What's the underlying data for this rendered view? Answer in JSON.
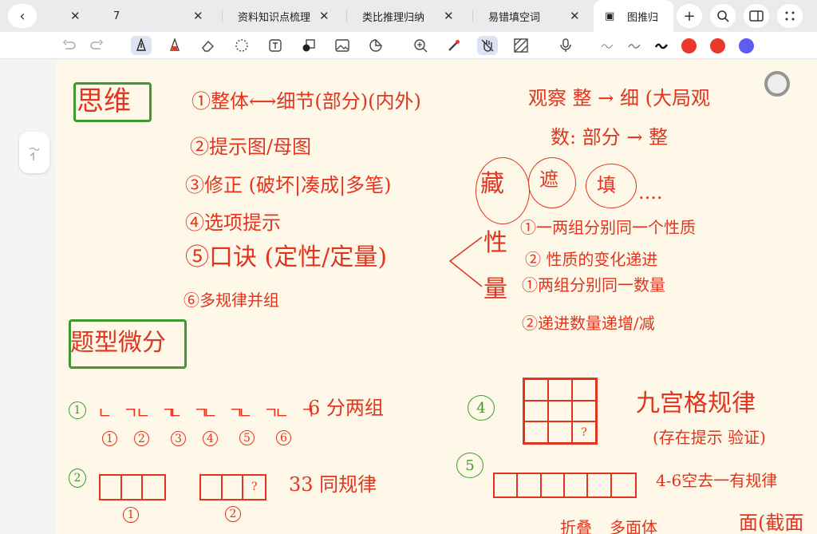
{
  "tabs": [
    {
      "label": "7"
    },
    {
      "label": "资料知识点梳理"
    },
    {
      "label": "类比推理归纳"
    },
    {
      "label": "易错填空词"
    },
    {
      "label": "图推归"
    }
  ],
  "colors": {
    "red1": "#e8392b",
    "red2": "#e8392b",
    "blue": "#5b5cf0",
    "ink_red": "#e2341e",
    "ink_green": "#3e9a2c"
  },
  "notes": {
    "title_siwei": "思维",
    "line1": "①整体⟷细节(部分)(内外)",
    "line2": "②提示图/母图",
    "line3": "③修正 (破坏|凑成|多笔)",
    "line4": "④选项提示",
    "line5": "⑤口诀 (定性/定量)",
    "line6": "⑥多规律并组",
    "observe1": "观察 整 → 细 (大局观",
    "observe2": "数: 部分 → 整",
    "cang": "藏",
    "zhe": "遮",
    "tian": "填",
    "dots": "....",
    "xing": "性",
    "liang": "量",
    "r1": "①一两组分别同一个性质",
    "r2": "② 性质的变化递进",
    "r3": "①两组分别同一数量",
    "r4": "②递进数量递增/减",
    "title_tixing": "题型微分",
    "s1_num": "1",
    "s1_glyph": "ㄴㄱ",
    "s1_labels": [
      "1",
      "2",
      "3",
      "4",
      "5",
      "6"
    ],
    "s1_desc": "6 分两组",
    "s2_num": "2",
    "s2_q": "?",
    "s2_lbl1": "1",
    "s2_lbl2": "2",
    "s2_desc": "33 同规律",
    "s4_num": "4",
    "s4_q": "?",
    "s4_title": "九宫格规律",
    "s4_sub": "(存在提示 验证)",
    "s5_num": "5",
    "s5_desc": "4-6空去一有规律",
    "bottom1": "折叠",
    "bottom2": "多面体",
    "bottom3": "面(截面"
  }
}
